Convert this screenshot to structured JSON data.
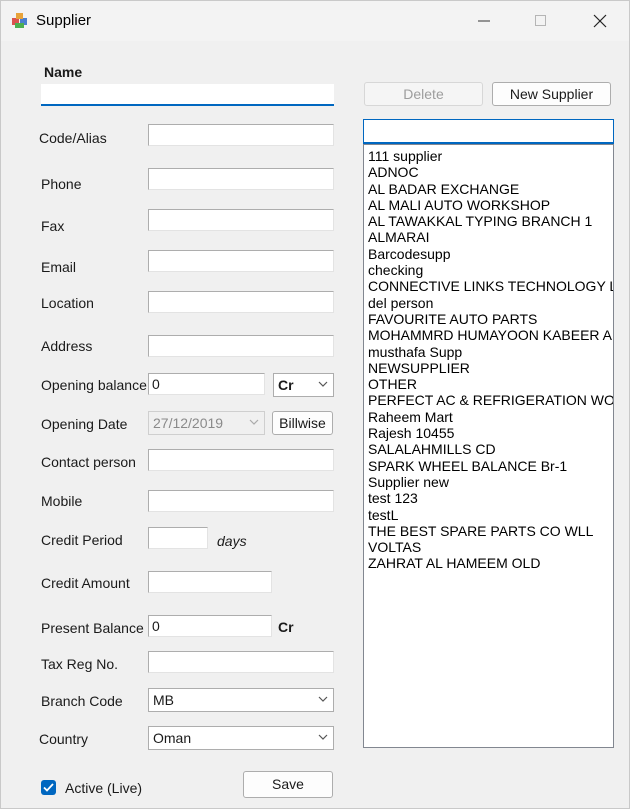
{
  "window": {
    "title": "Supplier",
    "icon": "app-icon"
  },
  "form": {
    "name_label": "Name",
    "name_value": "",
    "code_label": "Code/Alias",
    "phone_label": "Phone",
    "fax_label": "Fax",
    "email_label": "Email",
    "location_label": "Location",
    "address_label": "Address",
    "opening_balance_label": "Opening balance",
    "opening_balance_value": "0",
    "opening_balance_type": "Cr",
    "opening_date_label": "Opening Date",
    "opening_date_value": "27/12/2019",
    "billwise_label": "Billwise",
    "contact_person_label": "Contact person",
    "mobile_label": "Mobile",
    "credit_period_label": "Credit Period",
    "days_label": "days",
    "credit_amount_label": "Credit Amount",
    "present_balance_label": "Present Balance",
    "present_balance_value": "0",
    "present_balance_type": "Cr",
    "tax_reg_label": "Tax Reg No.",
    "branch_code_label": "Branch Code",
    "branch_code_value": "MB",
    "country_label": "Country",
    "country_value": "Oman",
    "active_label": "Active (Live)",
    "active_checked": true,
    "save_label": "Save"
  },
  "right_panel": {
    "delete_label": "Delete",
    "new_supplier_label": "New Supplier",
    "search_value": "",
    "suppliers": [
      "111 supplier",
      "ADNOC",
      "AL BADAR EXCHANGE",
      "AL MALI AUTO WORKSHOP",
      "AL TAWAKKAL TYPING BRANCH 1",
      "ALMARAI",
      "Barcodesupp",
      "checking",
      "CONNECTIVE LINKS TECHNOLOGY L.L",
      "del person",
      "FAVOURITE AUTO PARTS",
      "MOHAMMRD HUMAYOON KABEER AU",
      "musthafa Supp",
      "NEWSUPPLIER",
      "OTHER",
      "PERFECT AC & REFRIGERATION WOR",
      "Raheem Mart",
      "Rajesh 10455",
      "SALALAHMILLS CD",
      "SPARK WHEEL BALANCE Br-1",
      "Supplier new",
      "test 123",
      "testL",
      "THE BEST SPARE PARTS CO WLL",
      "VOLTAS",
      "ZAHRAT AL HAMEEM OLD"
    ]
  },
  "colors": {
    "accent": "#0067c0",
    "window_bg": "#f0f0f0"
  }
}
